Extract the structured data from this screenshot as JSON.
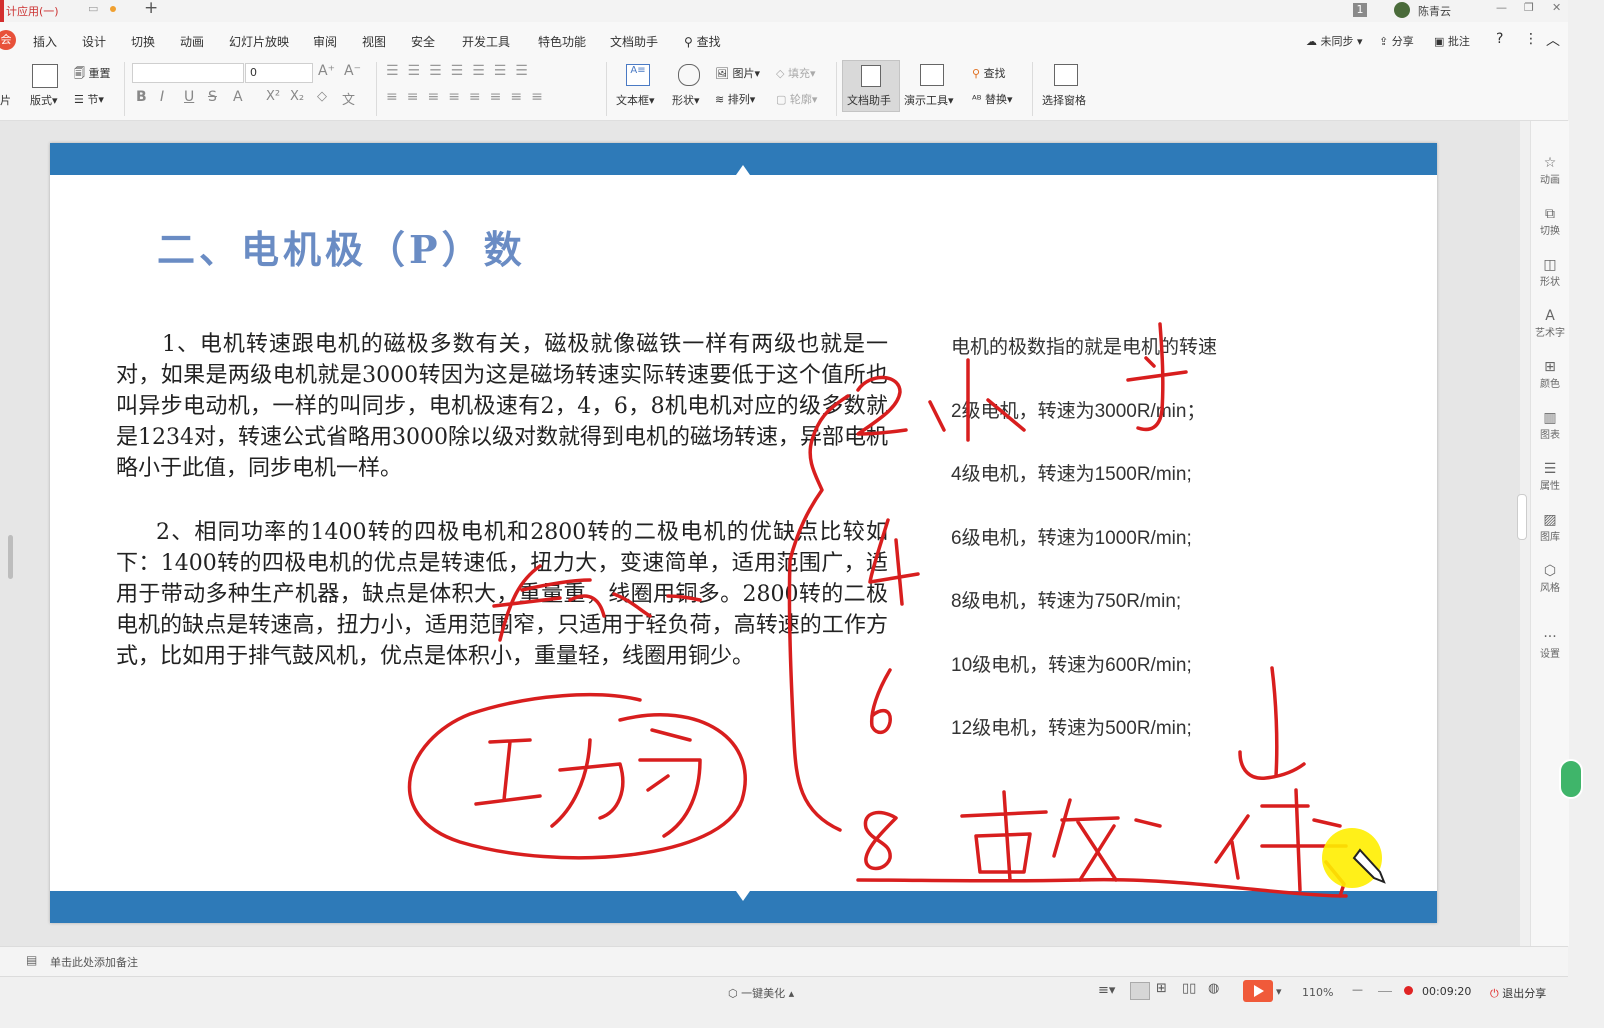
{
  "titlebar": {
    "doc_tab": "计应用(一)",
    "page_badge": "1",
    "user": "陈青云",
    "new_tab": "+"
  },
  "menu": {
    "logo": "会",
    "tabs": [
      "插入",
      "设计",
      "切换",
      "动画",
      "幻灯片放映",
      "审阅",
      "视图",
      "安全",
      "开发工具",
      "特色功能",
      "文档助手"
    ],
    "search": "查找",
    "sync": "未同步",
    "share": "分享",
    "comment": "批注",
    "help": "?"
  },
  "ribbon": {
    "layout": "版式",
    "reset": "重置",
    "section": "节",
    "font_name": "",
    "font_size": "0",
    "textbox": "文本框",
    "shape": "形状",
    "picture": "图片",
    "arrange": "排列",
    "fill": "填充",
    "outline": "轮廓",
    "doc_assistant": "文档助手",
    "presentation_tools": "演示工具",
    "find": "查找",
    "replace": "替换",
    "selection_pane": "选择窗格",
    "left_cut": "片"
  },
  "slide": {
    "title": "二、电机极（P）数",
    "para1": "1、电机转速跟电机的磁极多数有关，磁极就像磁铁一样有两级也就是一对，如果是两级电机就是3000转因为这是磁场转速实际转速要低于这个值所也叫异步电动机，一样的叫同步，电机极速有2，4，6，8机电机对应的级多数就是1234对，转速公式省略用3000除以级对数就得到电机的磁场转速，异部电机略小于此值，同步电机一样。",
    "para2": "2、相同功率的1400转的四极电机和2800转的二极电机的优缺点比较如下：1400转的四极电机的优点是转速低，扭力大，变速简单，适用范围广，适用于带动多种生产机器，缺点是体积大，重量重，线圈用铜多。2800转的二极电机的缺点是转速高，扭力小，适用范围窄，只适用于轻负荷，高转速的工作方式，比如用于排气鼓风机，优点是体积小，重量轻，线圈用铜少。",
    "right_lines": [
      "电机的极数指的就是电机的转速",
      "2级电机，转速为3000R/min；",
      "4级电机，转速为1500R/min;",
      "6级电机，转速为1000R/min;",
      "8级电机，转速为750R/min;",
      "10级电机，转速为600R/min;",
      "12级电机，转速为500R/min;"
    ]
  },
  "right_panel": [
    "动画",
    "切换",
    "形状",
    "艺术字",
    "颜色",
    "图表",
    "属性",
    "图库",
    "风格",
    "设置"
  ],
  "notes_placeholder": "单击此处添加备注",
  "status": {
    "beautify": "一键美化",
    "zoom": "110%",
    "timer": "00:09:20",
    "exit_share": "退出分享"
  },
  "colors": {
    "slide_bar": "#2e7ab8",
    "title": "#6a8cc4",
    "ink": "#d81e1e",
    "laser": "#ffee00",
    "play": "#f05a3a"
  }
}
